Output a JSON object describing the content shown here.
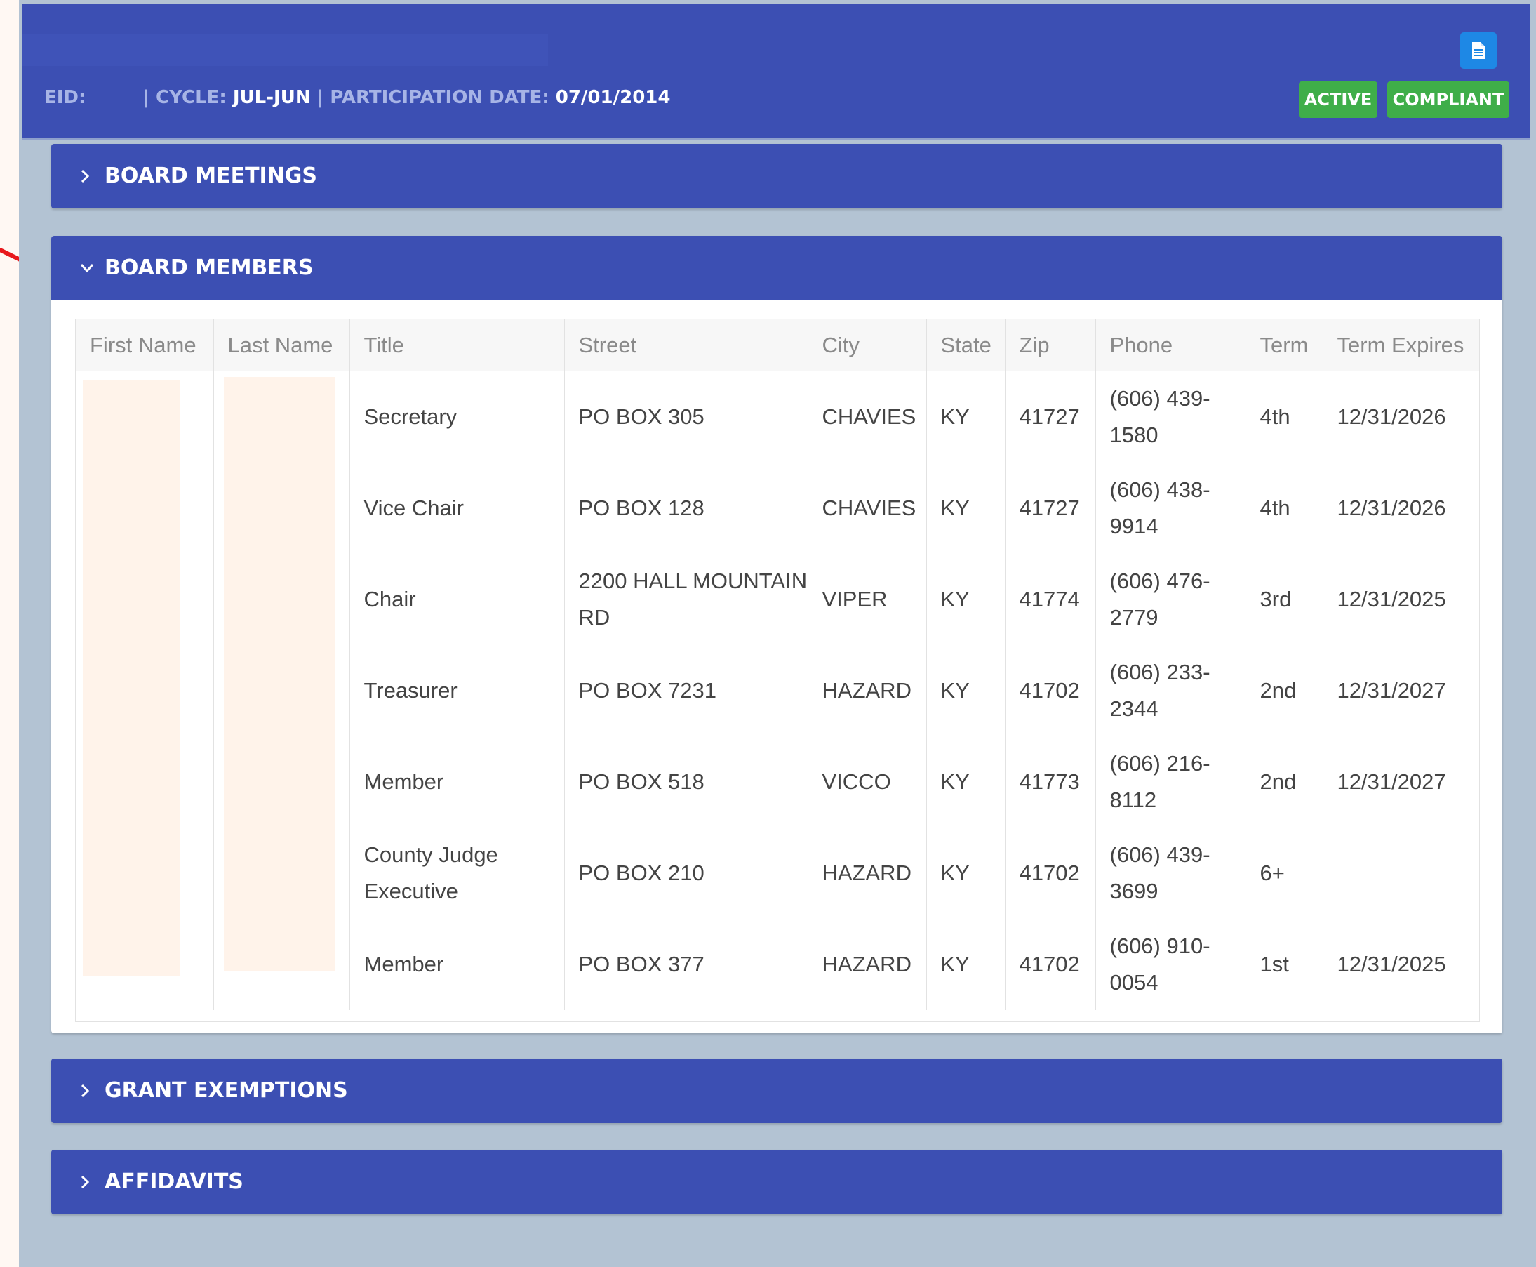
{
  "header": {
    "eid_label": "EID:",
    "cycle_label": "| CYCLE:",
    "cycle_value": "JUL-JUN",
    "participation_label": "| PARTICIPATION DATE:",
    "participation_value": "07/01/2014",
    "doc_icon": "document-icon",
    "badges": [
      "ACTIVE",
      "COMPLIANT"
    ]
  },
  "panels": {
    "meetings": "BOARD MEETINGS",
    "members": "BOARD MEMBERS",
    "grants": "GRANT EXEMPTIONS",
    "affidavits": "AFFIDAVITS"
  },
  "table": {
    "columns": [
      "First Name",
      "Last Name",
      "Title",
      "Street",
      "City",
      "State",
      "Zip",
      "Phone",
      "Term",
      "Term Expires"
    ],
    "rows": [
      {
        "first": "",
        "last": "",
        "title": "Secretary",
        "street": "PO BOX 305",
        "city": "CHAVIES",
        "state": "KY",
        "zip": "41727",
        "phone": "(606) 439-1580",
        "term": "4th",
        "expires": "12/31/2026"
      },
      {
        "first": "",
        "last": "",
        "title": "Vice Chair",
        "street": "PO BOX 128",
        "city": "CHAVIES",
        "state": "KY",
        "zip": "41727",
        "phone": "(606) 438-9914",
        "term": "4th",
        "expires": "12/31/2026"
      },
      {
        "first": "",
        "last": "",
        "title": "Chair",
        "street": "2200 HALL MOUNTAIN RD",
        "city": "VIPER",
        "state": "KY",
        "zip": "41774",
        "phone": "(606) 476-2779",
        "term": "3rd",
        "expires": "12/31/2025"
      },
      {
        "first": "",
        "last": "",
        "title": "Treasurer",
        "street": "PO BOX 7231",
        "city": "HAZARD",
        "state": "KY",
        "zip": "41702",
        "phone": "(606) 233-2344",
        "term": "2nd",
        "expires": "12/31/2027"
      },
      {
        "first": "",
        "last": "",
        "title": "Member",
        "street": "PO BOX 518",
        "city": "VICCO",
        "state": "KY",
        "zip": "41773",
        "phone": "(606) 216-8112",
        "term": "2nd",
        "expires": "12/31/2027"
      },
      {
        "first": "",
        "last": "",
        "title": "County Judge Executive",
        "street": "PO BOX 210",
        "city": "HAZARD",
        "state": "KY",
        "zip": "41702",
        "phone": "(606) 439-3699",
        "term": "6+",
        "expires": ""
      },
      {
        "first": "",
        "last": "",
        "title": "Member",
        "street": "PO BOX 377",
        "city": "HAZARD",
        "state": "KY",
        "zip": "41702",
        "phone": "(606) 910-0054",
        "term": "1st",
        "expires": "12/31/2025"
      }
    ]
  },
  "colors": {
    "header_bg": "#3c4fb3",
    "page_bg": "#b3c3d3",
    "badge_green": "#3fae49",
    "doc_button_blue": "#1e88e5",
    "annotation_arrow": "#e8191c"
  }
}
